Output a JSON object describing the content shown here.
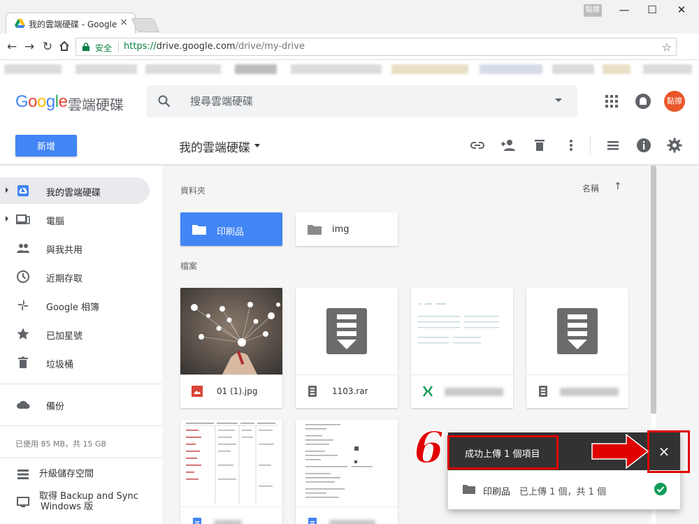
{
  "browser": {
    "tab_title": "我的雲端硬碟 - Google",
    "tab_close": "×",
    "user_badge": "點擦",
    "window_controls": {
      "minimize": "—",
      "maximize": "☐",
      "close": "✕"
    },
    "secure_label": "安全",
    "url_scheme": "https://",
    "url_host": "drive.google.com",
    "url_path": "/drive/my-drive",
    "menu_glyph": "⋮"
  },
  "drive": {
    "logo_letters": [
      "G",
      "o",
      "o",
      "g",
      "l",
      "e"
    ],
    "logo_colors": [
      "#4285F4",
      "#EA4335",
      "#FBBC05",
      "#4285F4",
      "#34A853",
      "#EA4335"
    ],
    "product_name": "雲端硬碟",
    "search_placeholder": "搜尋雲端硬碟",
    "avatar_text": "點擦",
    "new_button": "新增",
    "current_folder": "我的雲端硬碟",
    "accent_color": "#4285f4"
  },
  "sidebar": {
    "items": [
      {
        "label": "我的雲端硬碟",
        "icon": "drive-icon",
        "active": true,
        "expandable": true
      },
      {
        "label": "電腦",
        "icon": "computer-icon",
        "active": false,
        "expandable": true
      },
      {
        "label": "與我共用",
        "icon": "people-icon",
        "active": false,
        "expandable": false
      },
      {
        "label": "近期存取",
        "icon": "clock-icon",
        "active": false,
        "expandable": false
      },
      {
        "label": "Google 相簿",
        "icon": "photos-icon",
        "active": false,
        "expandable": false
      },
      {
        "label": "已加星號",
        "icon": "star-icon",
        "active": false,
        "expandable": false
      },
      {
        "label": "垃圾桶",
        "icon": "trash-icon",
        "active": false,
        "expandable": false
      }
    ],
    "backup": {
      "label": "備份",
      "icon": "cloud-icon"
    },
    "storage": "已使用 85 MB，共 15 GB",
    "upgrade": "升級儲存空間",
    "sync_line1": "取得 Backup and Sync",
    "sync_line2": "Windows 版"
  },
  "main": {
    "folders_label": "資料夾",
    "files_label": "檔案",
    "sort_label": "名稱",
    "sort_arrow": "↑",
    "folders": [
      {
        "name": "印刷品",
        "selected": true
      },
      {
        "name": "img",
        "selected": false
      }
    ],
    "files": [
      {
        "name": "01 (1).jpg",
        "type": "image"
      },
      {
        "name": "1103.rar",
        "type": "archive"
      },
      {
        "name": "",
        "type": "spreadsheet"
      },
      {
        "name": "",
        "type": "archive"
      },
      {
        "name": "",
        "type": "doc"
      },
      {
        "name": "",
        "type": "doc"
      }
    ]
  },
  "upload": {
    "title": "成功上傳 1 個項目",
    "close": "×",
    "item_name": "印刷品",
    "item_status": "已上傳 1 個，共 1 個"
  },
  "annotation": {
    "step": "6",
    "color": "#e00000"
  }
}
